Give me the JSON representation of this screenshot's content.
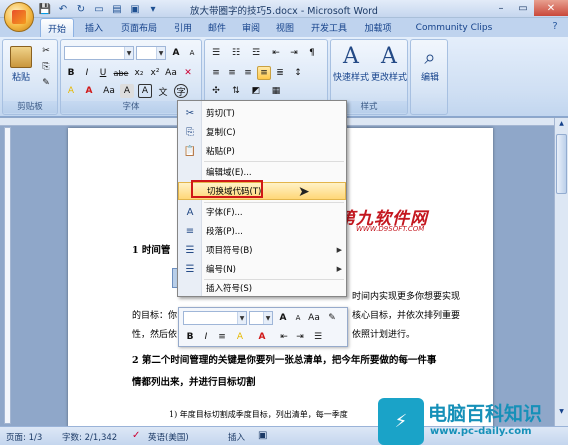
{
  "window": {
    "title": "放大带圈字的技巧5.docx - Microsoft Word"
  },
  "tabs": [
    "开始",
    "插入",
    "页面布局",
    "引用",
    "邮件",
    "审阅",
    "视图",
    "开发工具",
    "加载项",
    "Community Clips"
  ],
  "ribbon": {
    "clipboard": {
      "paste": "粘贴",
      "label": "剪贴板"
    },
    "font": {
      "label": "字体",
      "bold": "B",
      "italic": "I",
      "underline": "U",
      "strike": "abe",
      "sub": "x₂",
      "super": "x²",
      "aa": "Aa",
      "grow": "A",
      "shrink": "A",
      "clear": "A",
      "color": "A",
      "highlight": "A",
      "shade": "A",
      "char_border": "A",
      "phonetic": "文",
      "enclosed": "字"
    },
    "paragraph": {
      "label": "段落"
    },
    "styles": {
      "quick": "快速样式",
      "change": "更改样式",
      "label": "样式"
    },
    "editing": {
      "label": "编辑"
    }
  },
  "context_menu": [
    {
      "icon": "✂",
      "label": "剪切(T)"
    },
    {
      "icon": "⎘",
      "label": "复制(C)"
    },
    {
      "icon": "📋",
      "label": "粘贴(P)"
    },
    {
      "icon": "",
      "label": "编辑域(E)..."
    },
    {
      "icon": "",
      "label": "切换域代码(T)"
    },
    {
      "icon": "A",
      "label": "字体(F)..."
    },
    {
      "icon": "≡",
      "label": "段落(P)..."
    },
    {
      "icon": "☰",
      "label": "项目符号(B)"
    },
    {
      "icon": "☰",
      "label": "编号(N)"
    },
    {
      "icon": "",
      "label": "插入符号(S)"
    }
  ],
  "document": {
    "h1": "1  时间管",
    "p1a": "时间内实现更多你想要实现",
    "p1b": "的目标：你",
    "p1c": "核心目标，并依次排列重要",
    "p2a": "性，然后依",
    "p2b": "依照计划进行。",
    "h2a": "2  第二个时间管理的关键是你要列一张总清单，把今年所要做的每一件事",
    "h2b": "情都列出来，并进行目标切割",
    "p3": "1) 年度目标切割成季度目标，列出清单，每一季度"
  },
  "status": {
    "page": "页面: 1/3",
    "words": "字数: 2/1,342",
    "lang": "英语(美国)",
    "mode": "插入"
  },
  "watermarks": {
    "w1": "第九软件网",
    "w2": "WWW.D9SOFT.COM",
    "w3": "电脑百科知识",
    "w4": "www.pc-daily.com"
  }
}
